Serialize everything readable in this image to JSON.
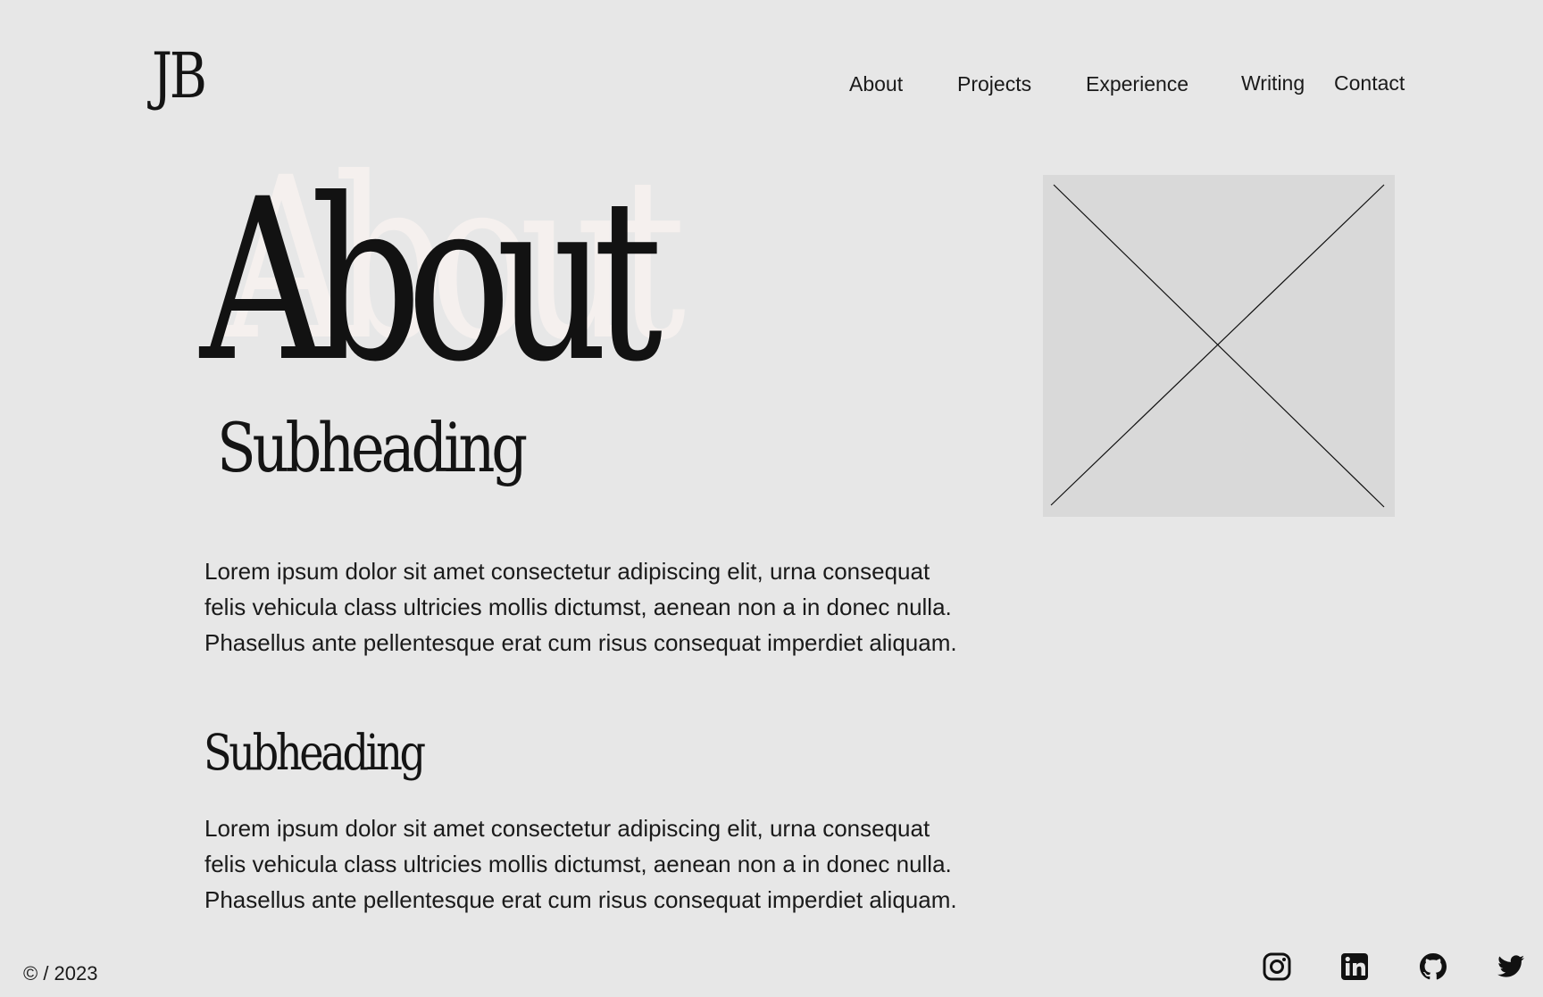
{
  "header": {
    "logo": "JB",
    "nav": [
      "About",
      "Projects",
      "Experience",
      "Writing",
      "Contact"
    ]
  },
  "hero": {
    "title": "About",
    "subheading": "Subheading"
  },
  "content": {
    "paragraph_1": "Lorem ipsum dolor sit amet consectetur adipiscing elit, urna consequat felis vehicula class ultricies mollis dictumst, aenean non a in donec nulla. Phasellus ante pellentesque erat cum risus consequat imperdiet aliquam.",
    "subheading_2": "Subheading",
    "paragraph_2": "Lorem ipsum dolor sit amet consectetur adipiscing elit, urna consequat felis vehicula class ultricies mollis dictumst, aenean non a in donec nulla. Phasellus ante pellentesque erat cum risus consequat imperdiet aliquam."
  },
  "footer": {
    "copyright": "© / 2023",
    "socials": [
      "instagram-icon",
      "linkedin-icon",
      "github-icon",
      "twitter-icon"
    ]
  },
  "colors": {
    "background": "#e7e7e7",
    "text": "#141414",
    "placeholder": "#d9d9d9",
    "hero_shadow": "#f5f0ee"
  }
}
